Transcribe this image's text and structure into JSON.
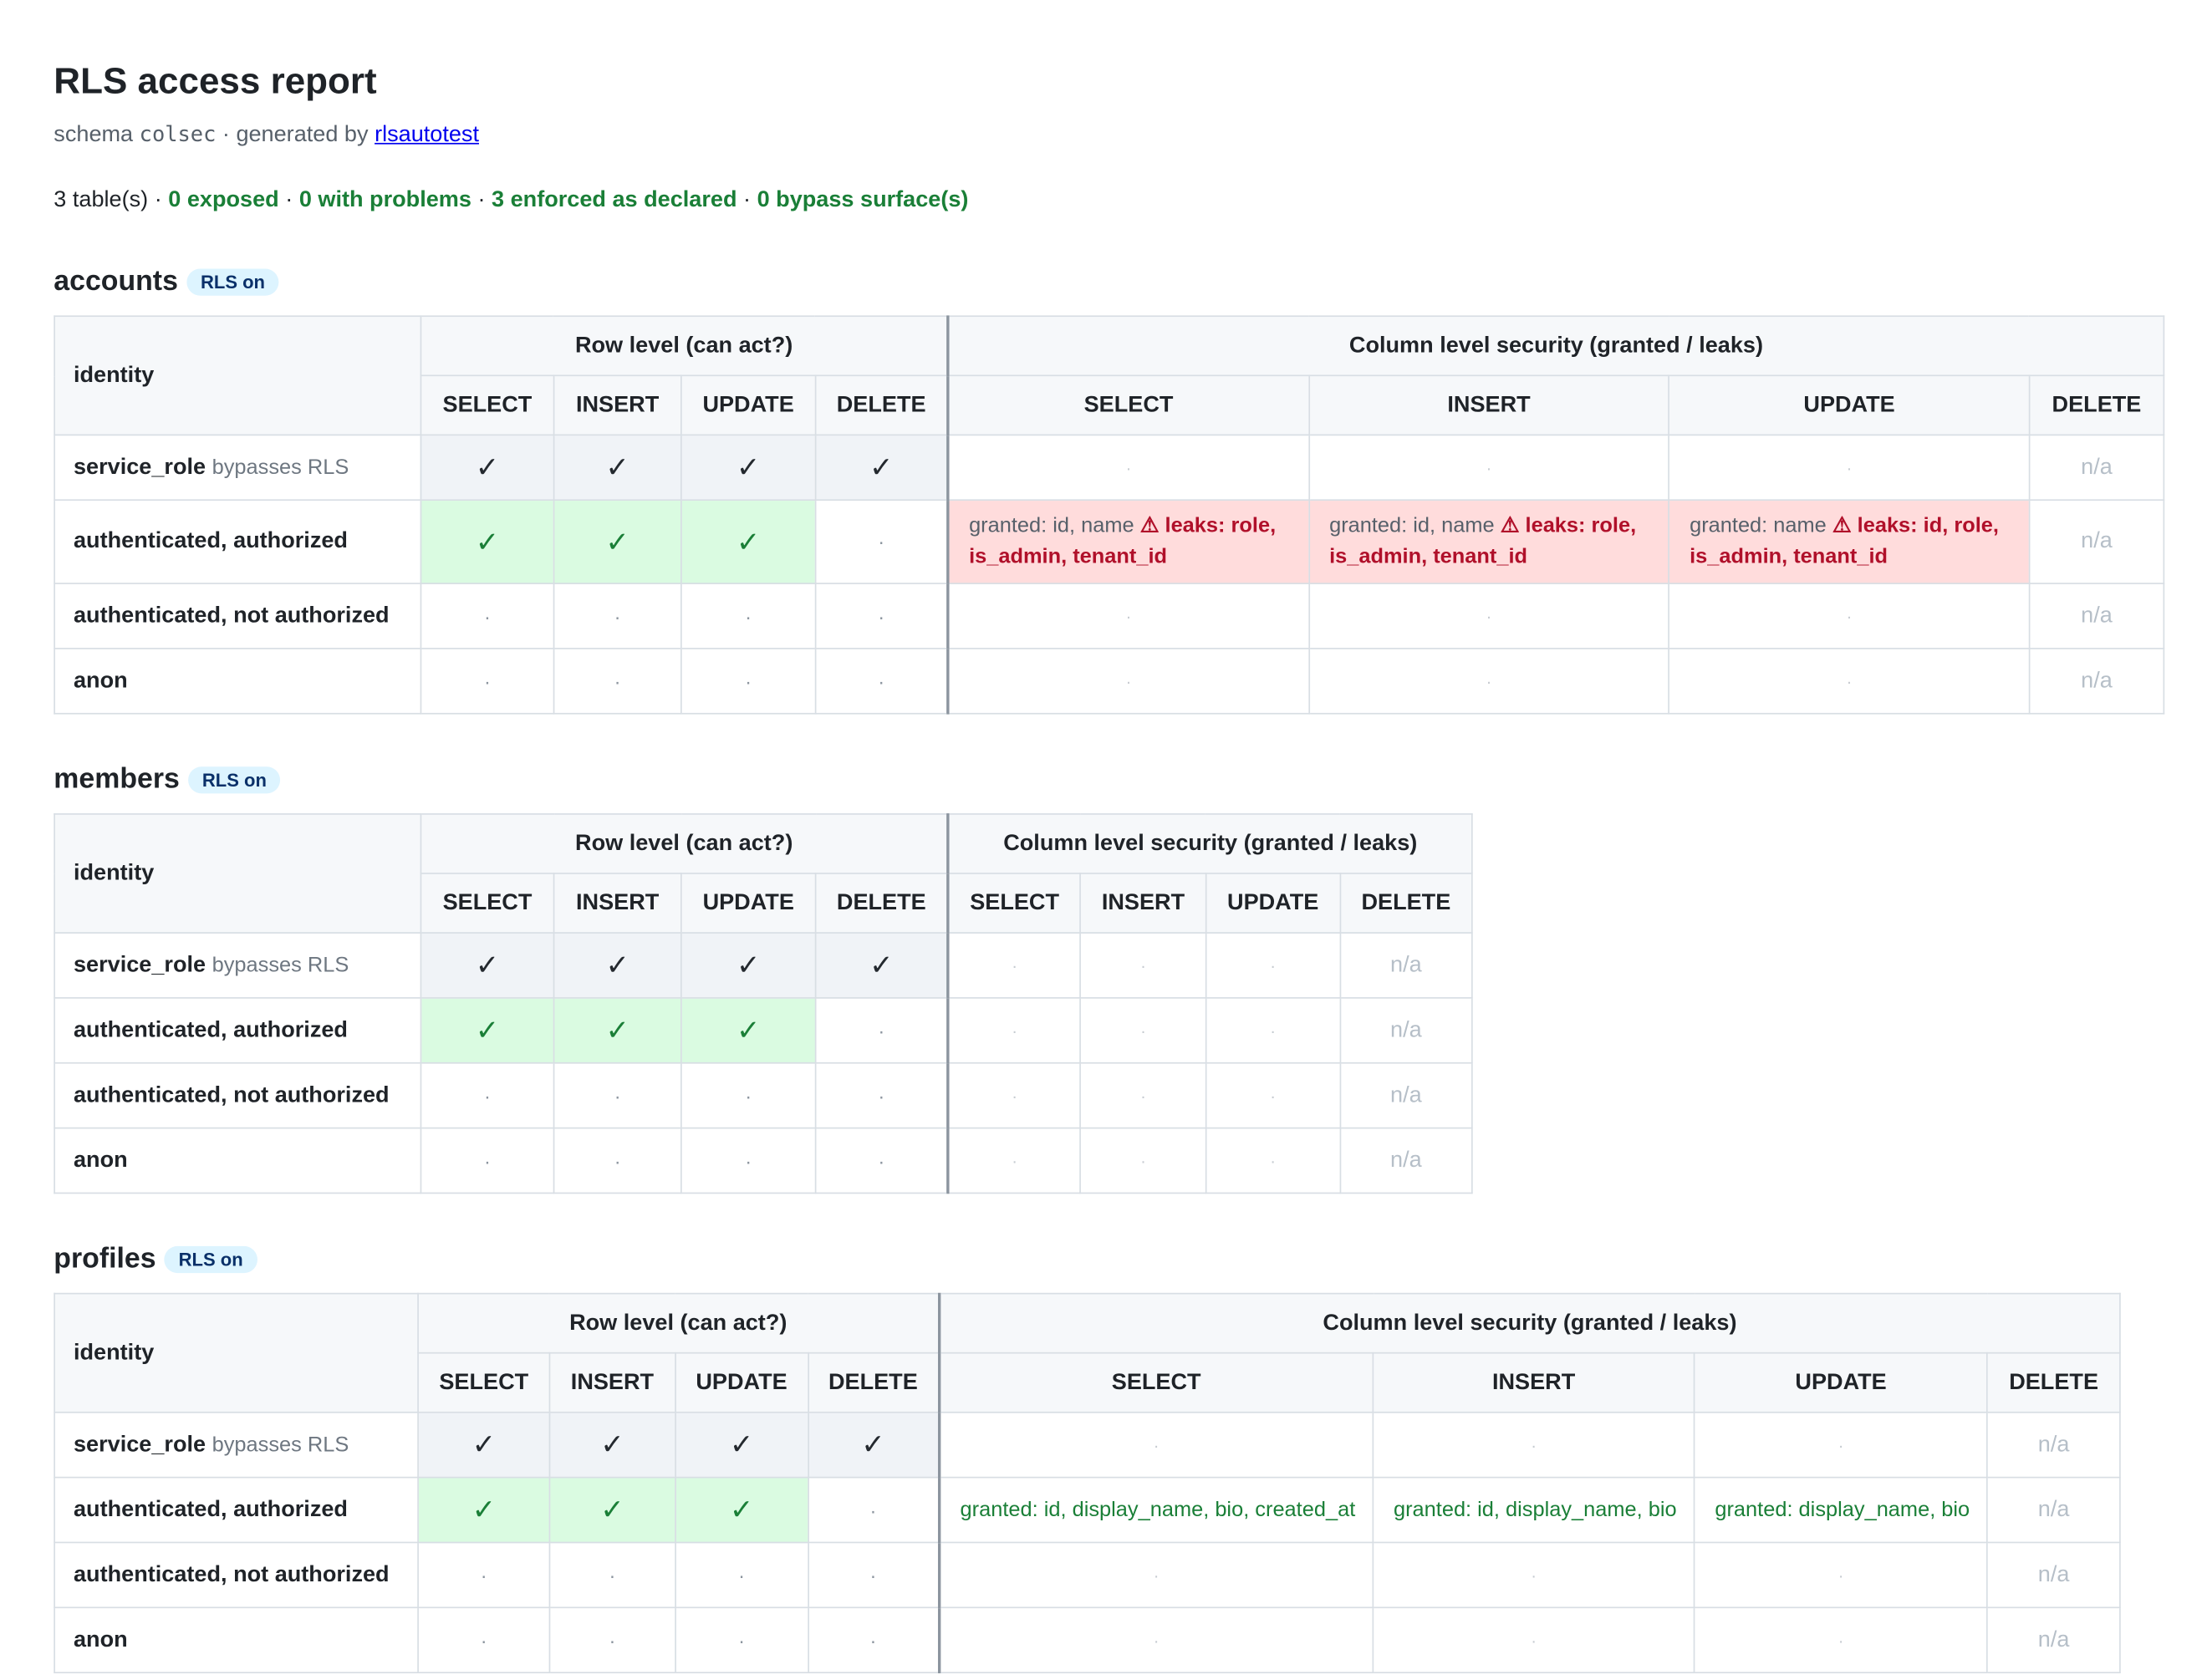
{
  "header": {
    "title": "RLS access report",
    "schema_prefix": "schema",
    "schema_name": "colsec",
    "generated_by_prefix": "· generated by",
    "generator_link": "rlsautotest"
  },
  "summary": {
    "tables": "3 table(s)",
    "sep": "·",
    "exposed": "0 exposed",
    "problems": "0 with problems",
    "enforced": "3 enforced as declared",
    "bypass": "0 bypass surface(s)"
  },
  "common": {
    "rls_badge": "RLS on",
    "identity_header": "identity",
    "row_level_header": "Row level (can act?)",
    "col_level_header": "Column level security (granted / leaks)",
    "ops": [
      "SELECT",
      "INSERT",
      "UPDATE",
      "DELETE"
    ],
    "check": "✓",
    "dot": "·",
    "na": "n/a",
    "identities": {
      "service_role": "service_role",
      "service_role_note": "bypasses RLS",
      "auth_authorized": "authenticated, authorized",
      "auth_not_authorized": "authenticated, not authorized",
      "anon": "anon"
    }
  },
  "tables": [
    {
      "name": "accounts",
      "authorized_cls": [
        {
          "granted": "granted: id, name",
          "leaks": "⚠ leaks: role, is_admin, tenant_id"
        },
        {
          "granted": "granted: id, name",
          "leaks": "⚠ leaks: role, is_admin, tenant_id"
        },
        {
          "granted": "granted: name",
          "leaks": "⚠ leaks: id, role, is_admin, tenant_id"
        }
      ]
    },
    {
      "name": "members"
    },
    {
      "name": "profiles",
      "authorized_cls": [
        {
          "granted": "granted: id, display_name, bio, created_at"
        },
        {
          "granted": "granted: id, display_name, bio"
        },
        {
          "granted": "granted: display_name, bio"
        }
      ]
    }
  ],
  "colors": {
    "ok_green": "#1a7f37",
    "ok_bg": "#dafbe1",
    "leak_bg": "#ffdcdc",
    "leak_text": "#b0102a",
    "badge_bg": "#ddf4ff"
  }
}
